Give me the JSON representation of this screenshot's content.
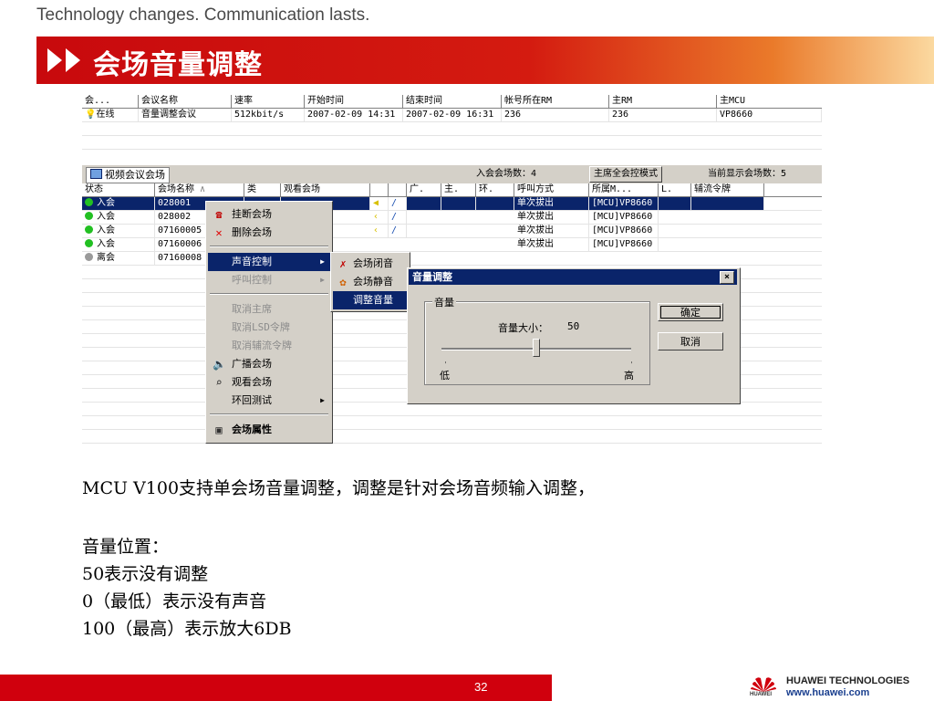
{
  "header": {
    "tagline": "Technology changes. Communication lasts.",
    "title": "会场音量调整"
  },
  "conf_table": {
    "columns": [
      "会...",
      "会议名称",
      "速率",
      "开始时间",
      "结束时间",
      "帐号所在RM",
      "主RM",
      "主MCU"
    ],
    "row": [
      "在线",
      "音量调整会议",
      "512kbit/s",
      "2007-02-09 14:31",
      "2007-02-09 16:31",
      "236",
      "236",
      "VP8660"
    ]
  },
  "panel": {
    "tab_label": "视频会议会场",
    "count_text": "入会会场数：4",
    "mode_button": "主席全会控模式",
    "display_count": "当前显示会场数：5"
  },
  "site_table": {
    "columns": [
      "状态",
      "会场名称",
      "类",
      "观看会场",
      "",
      "",
      "广.",
      "主.",
      "环.",
      "呼叫方式",
      "所属M...",
      "L.",
      "辅流令牌"
    ],
    "rows": [
      {
        "status": "入会",
        "name": "028001",
        "call": "单次拔出",
        "mcu": "[MCU]VP8660",
        "status_color": "#22c022"
      },
      {
        "status": "入会",
        "name": "028002",
        "call": "单次拔出",
        "mcu": "[MCU]VP8660",
        "status_color": "#22c022"
      },
      {
        "status": "入会",
        "name": "07160005",
        "call": "单次拔出",
        "mcu": "[MCU]VP8660",
        "status_color": "#22c022"
      },
      {
        "status": "入会",
        "name": "07160006",
        "call": "单次拔出",
        "mcu": "[MCU]VP8660",
        "status_color": "#22c022"
      },
      {
        "status": "离会",
        "name": "07160008",
        "call": "",
        "mcu": "",
        "status_color": "#9a9a9a"
      }
    ]
  },
  "context_menu": {
    "items": [
      {
        "label": "挂断会场",
        "icon": "hangup-icon",
        "disabled": false
      },
      {
        "label": "删除会场",
        "icon": "delete-icon",
        "disabled": false
      },
      {
        "label": "声音控制",
        "icon": "",
        "disabled": false,
        "submenu": true,
        "highlighted": true
      },
      {
        "label": "呼叫控制",
        "icon": "",
        "disabled": true,
        "submenu": true
      },
      {
        "label": "取消主席",
        "icon": "",
        "disabled": true
      },
      {
        "label": "取消LSD令牌",
        "icon": "",
        "disabled": true
      },
      {
        "label": "取消辅流令牌",
        "icon": "",
        "disabled": true
      },
      {
        "label": "广播会场",
        "icon": "broadcast-icon",
        "disabled": false
      },
      {
        "label": "观看会场",
        "icon": "view-icon",
        "disabled": false
      },
      {
        "label": "环回测试",
        "icon": "",
        "disabled": false,
        "submenu": true
      },
      {
        "label": "会场属性",
        "icon": "properties-icon",
        "disabled": false,
        "bold": true
      }
    ]
  },
  "sound_submenu": {
    "items": [
      "会场闭音",
      "会场静音",
      "调整音量"
    ]
  },
  "volume_dialog": {
    "title": "音量调整",
    "close": "×",
    "group_label": "音量",
    "volume_label": "音量大小：",
    "volume_value": "50",
    "volume_level": 0.5,
    "low_label": "低",
    "high_label": "高",
    "ok_button": "确定",
    "cancel_button": "取消"
  },
  "body": {
    "line1": "MCU V100支持单会场音量调整，调整是针对会场音频输入调整，",
    "line2": "音量位置：",
    "line3": "50表示没有调整",
    "line4": "0（最低）表示没有声音",
    "line5": "100（最高）表示放大6DB"
  },
  "footer": {
    "page_number": "32",
    "company": "HUAWEI TECHNOLOGIES",
    "url": "www.huawei.com",
    "logo_text": "HUAWEI"
  },
  "colors": {
    "brand_red": "#c8090d",
    "selection": "#0a246a",
    "window_gray": "#d4d0c8"
  }
}
